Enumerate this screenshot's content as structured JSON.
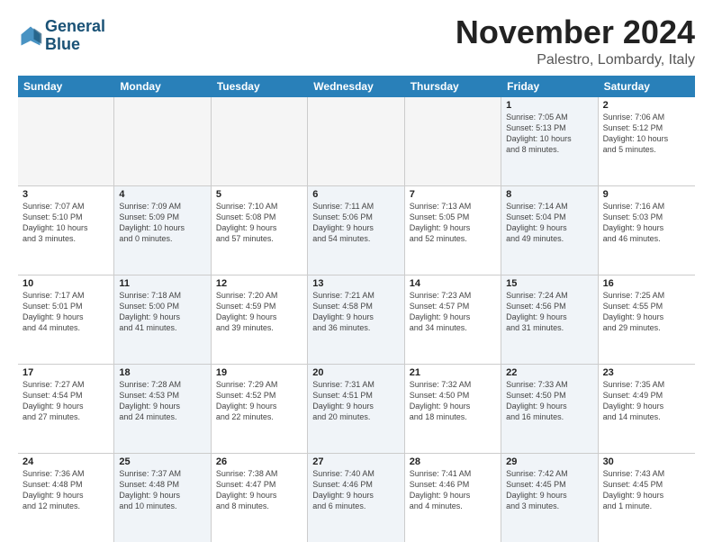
{
  "header": {
    "logo_line1": "General",
    "logo_line2": "Blue",
    "month": "November 2024",
    "location": "Palestro, Lombardy, Italy"
  },
  "weekdays": [
    "Sunday",
    "Monday",
    "Tuesday",
    "Wednesday",
    "Thursday",
    "Friday",
    "Saturday"
  ],
  "rows": [
    [
      {
        "day": "",
        "info": "",
        "empty": true
      },
      {
        "day": "",
        "info": "",
        "empty": true
      },
      {
        "day": "",
        "info": "",
        "empty": true
      },
      {
        "day": "",
        "info": "",
        "empty": true
      },
      {
        "day": "",
        "info": "",
        "empty": true
      },
      {
        "day": "1",
        "info": "Sunrise: 7:05 AM\nSunset: 5:13 PM\nDaylight: 10 hours\nand 8 minutes.",
        "shaded": true
      },
      {
        "day": "2",
        "info": "Sunrise: 7:06 AM\nSunset: 5:12 PM\nDaylight: 10 hours\nand 5 minutes.",
        "shaded": false
      }
    ],
    [
      {
        "day": "3",
        "info": "Sunrise: 7:07 AM\nSunset: 5:10 PM\nDaylight: 10 hours\nand 3 minutes.",
        "shaded": false
      },
      {
        "day": "4",
        "info": "Sunrise: 7:09 AM\nSunset: 5:09 PM\nDaylight: 10 hours\nand 0 minutes.",
        "shaded": true
      },
      {
        "day": "5",
        "info": "Sunrise: 7:10 AM\nSunset: 5:08 PM\nDaylight: 9 hours\nand 57 minutes.",
        "shaded": false
      },
      {
        "day": "6",
        "info": "Sunrise: 7:11 AM\nSunset: 5:06 PM\nDaylight: 9 hours\nand 54 minutes.",
        "shaded": true
      },
      {
        "day": "7",
        "info": "Sunrise: 7:13 AM\nSunset: 5:05 PM\nDaylight: 9 hours\nand 52 minutes.",
        "shaded": false
      },
      {
        "day": "8",
        "info": "Sunrise: 7:14 AM\nSunset: 5:04 PM\nDaylight: 9 hours\nand 49 minutes.",
        "shaded": true
      },
      {
        "day": "9",
        "info": "Sunrise: 7:16 AM\nSunset: 5:03 PM\nDaylight: 9 hours\nand 46 minutes.",
        "shaded": false
      }
    ],
    [
      {
        "day": "10",
        "info": "Sunrise: 7:17 AM\nSunset: 5:01 PM\nDaylight: 9 hours\nand 44 minutes.",
        "shaded": false
      },
      {
        "day": "11",
        "info": "Sunrise: 7:18 AM\nSunset: 5:00 PM\nDaylight: 9 hours\nand 41 minutes.",
        "shaded": true
      },
      {
        "day": "12",
        "info": "Sunrise: 7:20 AM\nSunset: 4:59 PM\nDaylight: 9 hours\nand 39 minutes.",
        "shaded": false
      },
      {
        "day": "13",
        "info": "Sunrise: 7:21 AM\nSunset: 4:58 PM\nDaylight: 9 hours\nand 36 minutes.",
        "shaded": true
      },
      {
        "day": "14",
        "info": "Sunrise: 7:23 AM\nSunset: 4:57 PM\nDaylight: 9 hours\nand 34 minutes.",
        "shaded": false
      },
      {
        "day": "15",
        "info": "Sunrise: 7:24 AM\nSunset: 4:56 PM\nDaylight: 9 hours\nand 31 minutes.",
        "shaded": true
      },
      {
        "day": "16",
        "info": "Sunrise: 7:25 AM\nSunset: 4:55 PM\nDaylight: 9 hours\nand 29 minutes.",
        "shaded": false
      }
    ],
    [
      {
        "day": "17",
        "info": "Sunrise: 7:27 AM\nSunset: 4:54 PM\nDaylight: 9 hours\nand 27 minutes.",
        "shaded": false
      },
      {
        "day": "18",
        "info": "Sunrise: 7:28 AM\nSunset: 4:53 PM\nDaylight: 9 hours\nand 24 minutes.",
        "shaded": true
      },
      {
        "day": "19",
        "info": "Sunrise: 7:29 AM\nSunset: 4:52 PM\nDaylight: 9 hours\nand 22 minutes.",
        "shaded": false
      },
      {
        "day": "20",
        "info": "Sunrise: 7:31 AM\nSunset: 4:51 PM\nDaylight: 9 hours\nand 20 minutes.",
        "shaded": true
      },
      {
        "day": "21",
        "info": "Sunrise: 7:32 AM\nSunset: 4:50 PM\nDaylight: 9 hours\nand 18 minutes.",
        "shaded": false
      },
      {
        "day": "22",
        "info": "Sunrise: 7:33 AM\nSunset: 4:50 PM\nDaylight: 9 hours\nand 16 minutes.",
        "shaded": true
      },
      {
        "day": "23",
        "info": "Sunrise: 7:35 AM\nSunset: 4:49 PM\nDaylight: 9 hours\nand 14 minutes.",
        "shaded": false
      }
    ],
    [
      {
        "day": "24",
        "info": "Sunrise: 7:36 AM\nSunset: 4:48 PM\nDaylight: 9 hours\nand 12 minutes.",
        "shaded": false
      },
      {
        "day": "25",
        "info": "Sunrise: 7:37 AM\nSunset: 4:48 PM\nDaylight: 9 hours\nand 10 minutes.",
        "shaded": true
      },
      {
        "day": "26",
        "info": "Sunrise: 7:38 AM\nSunset: 4:47 PM\nDaylight: 9 hours\nand 8 minutes.",
        "shaded": false
      },
      {
        "day": "27",
        "info": "Sunrise: 7:40 AM\nSunset: 4:46 PM\nDaylight: 9 hours\nand 6 minutes.",
        "shaded": true
      },
      {
        "day": "28",
        "info": "Sunrise: 7:41 AM\nSunset: 4:46 PM\nDaylight: 9 hours\nand 4 minutes.",
        "shaded": false
      },
      {
        "day": "29",
        "info": "Sunrise: 7:42 AM\nSunset: 4:45 PM\nDaylight: 9 hours\nand 3 minutes.",
        "shaded": true
      },
      {
        "day": "30",
        "info": "Sunrise: 7:43 AM\nSunset: 4:45 PM\nDaylight: 9 hours\nand 1 minute.",
        "shaded": false
      }
    ]
  ]
}
